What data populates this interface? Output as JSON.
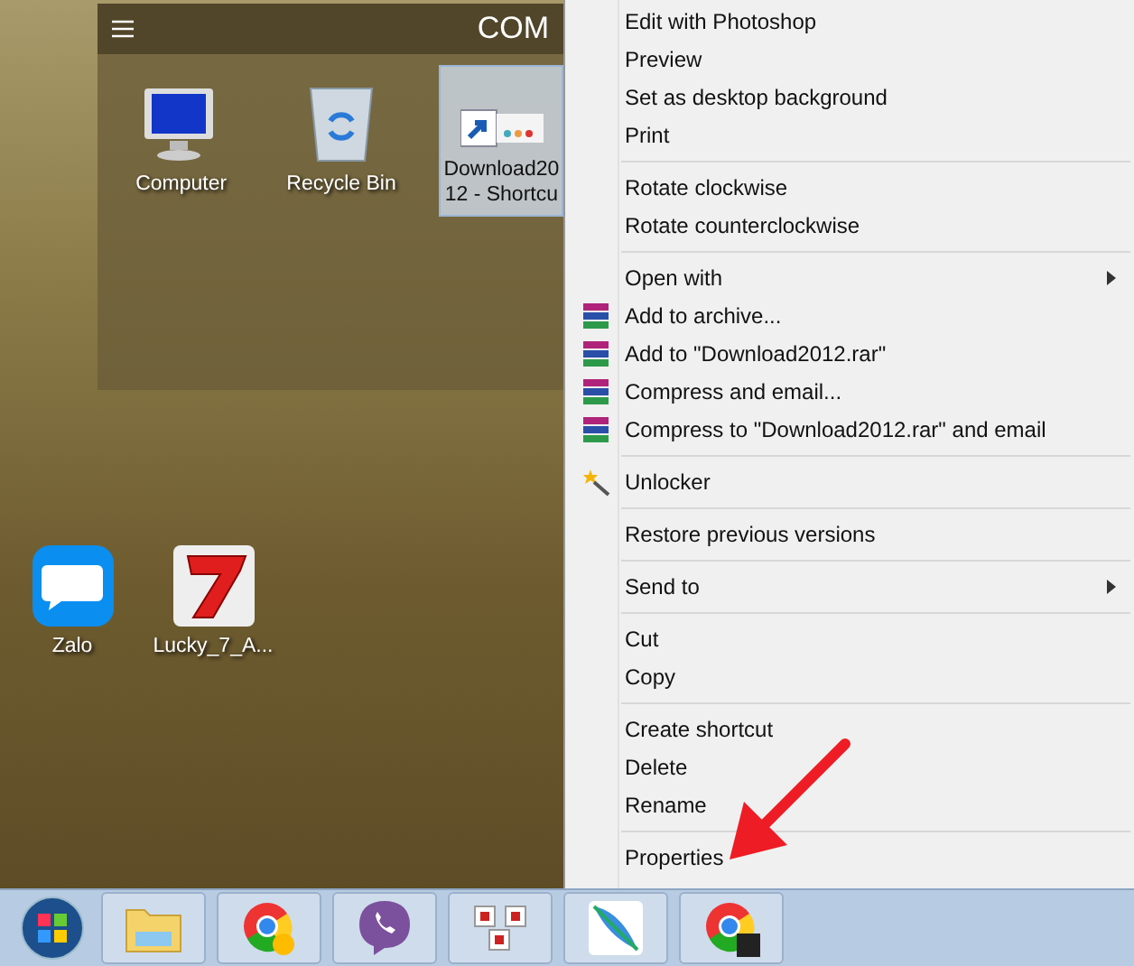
{
  "desktop_widget": {
    "title": "COM",
    "icons": [
      {
        "kind": "computer",
        "label": "Computer",
        "selected": false
      },
      {
        "kind": "recycle",
        "label": "Recycle Bin",
        "selected": false
      },
      {
        "kind": "shortcut",
        "label": "Download2012 - Shortcu",
        "selected": true
      }
    ]
  },
  "desktop_icons": [
    {
      "kind": "zalo",
      "label": "Zalo",
      "selected": false
    },
    {
      "kind": "seven",
      "label": "Lucky_7_A...",
      "selected": false
    }
  ],
  "context_menu": {
    "items": [
      {
        "kind": "item",
        "label": "Edit with Photoshop"
      },
      {
        "kind": "item",
        "label": "Preview"
      },
      {
        "kind": "item",
        "label": "Set as desktop background"
      },
      {
        "kind": "item",
        "label": "Print"
      },
      {
        "kind": "separator"
      },
      {
        "kind": "item",
        "label": "Rotate clockwise"
      },
      {
        "kind": "item",
        "label": "Rotate counterclockwise"
      },
      {
        "kind": "separator"
      },
      {
        "kind": "submenu",
        "label": "Open with"
      },
      {
        "kind": "archive",
        "label": "Add to archive..."
      },
      {
        "kind": "archive",
        "label": "Add to \"Download2012.rar\""
      },
      {
        "kind": "archive",
        "label": "Compress and email..."
      },
      {
        "kind": "archive",
        "label": "Compress to \"Download2012.rar\" and email"
      },
      {
        "kind": "separator"
      },
      {
        "kind": "unlocker",
        "label": "Unlocker"
      },
      {
        "kind": "separator"
      },
      {
        "kind": "item",
        "label": "Restore previous versions"
      },
      {
        "kind": "separator"
      },
      {
        "kind": "submenu",
        "label": "Send to"
      },
      {
        "kind": "separator"
      },
      {
        "kind": "item",
        "label": "Cut"
      },
      {
        "kind": "item",
        "label": "Copy"
      },
      {
        "kind": "separator"
      },
      {
        "kind": "item",
        "label": "Create shortcut"
      },
      {
        "kind": "item",
        "label": "Delete"
      },
      {
        "kind": "item",
        "label": "Rename"
      },
      {
        "kind": "separator"
      },
      {
        "kind": "item",
        "label": "Properties"
      }
    ]
  },
  "taskbar": {
    "buttons": [
      {
        "kind": "start"
      },
      {
        "kind": "folder"
      },
      {
        "kind": "chrome"
      },
      {
        "kind": "viber"
      },
      {
        "kind": "unikey"
      },
      {
        "kind": "feather"
      },
      {
        "kind": "chrome2"
      }
    ]
  }
}
